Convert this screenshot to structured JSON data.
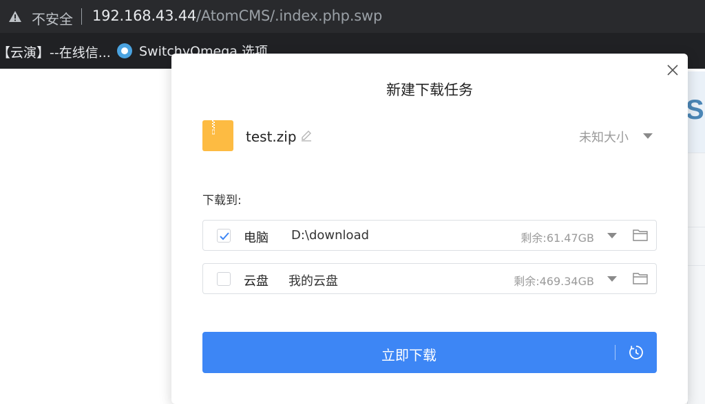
{
  "browser": {
    "security_label": "不安全",
    "url_host": "192.168.43.44",
    "url_path": "/AtomCMS/.index.php.swp",
    "bookmarks": [
      {
        "label": "【云演】--在线信..."
      },
      {
        "label": "SwitchyOmega 选项"
      }
    ]
  },
  "background": {
    "partial_letter": "S"
  },
  "dialog": {
    "title": "新建下载任务",
    "file": {
      "name": "test.zip",
      "size": "未知大小"
    },
    "save_to_label": "下载到:",
    "targets": [
      {
        "name": "电脑",
        "path": "D:\\download",
        "free": "剩余:61.47GB",
        "checked": true
      },
      {
        "name": "云盘",
        "path": "我的云盘",
        "free": "剩余:469.34GB",
        "checked": false
      }
    ],
    "download_button": "立即下载"
  },
  "colors": {
    "primary": "#3d86f5",
    "file_icon": "#fdbb42",
    "check": "#3d86f5"
  }
}
